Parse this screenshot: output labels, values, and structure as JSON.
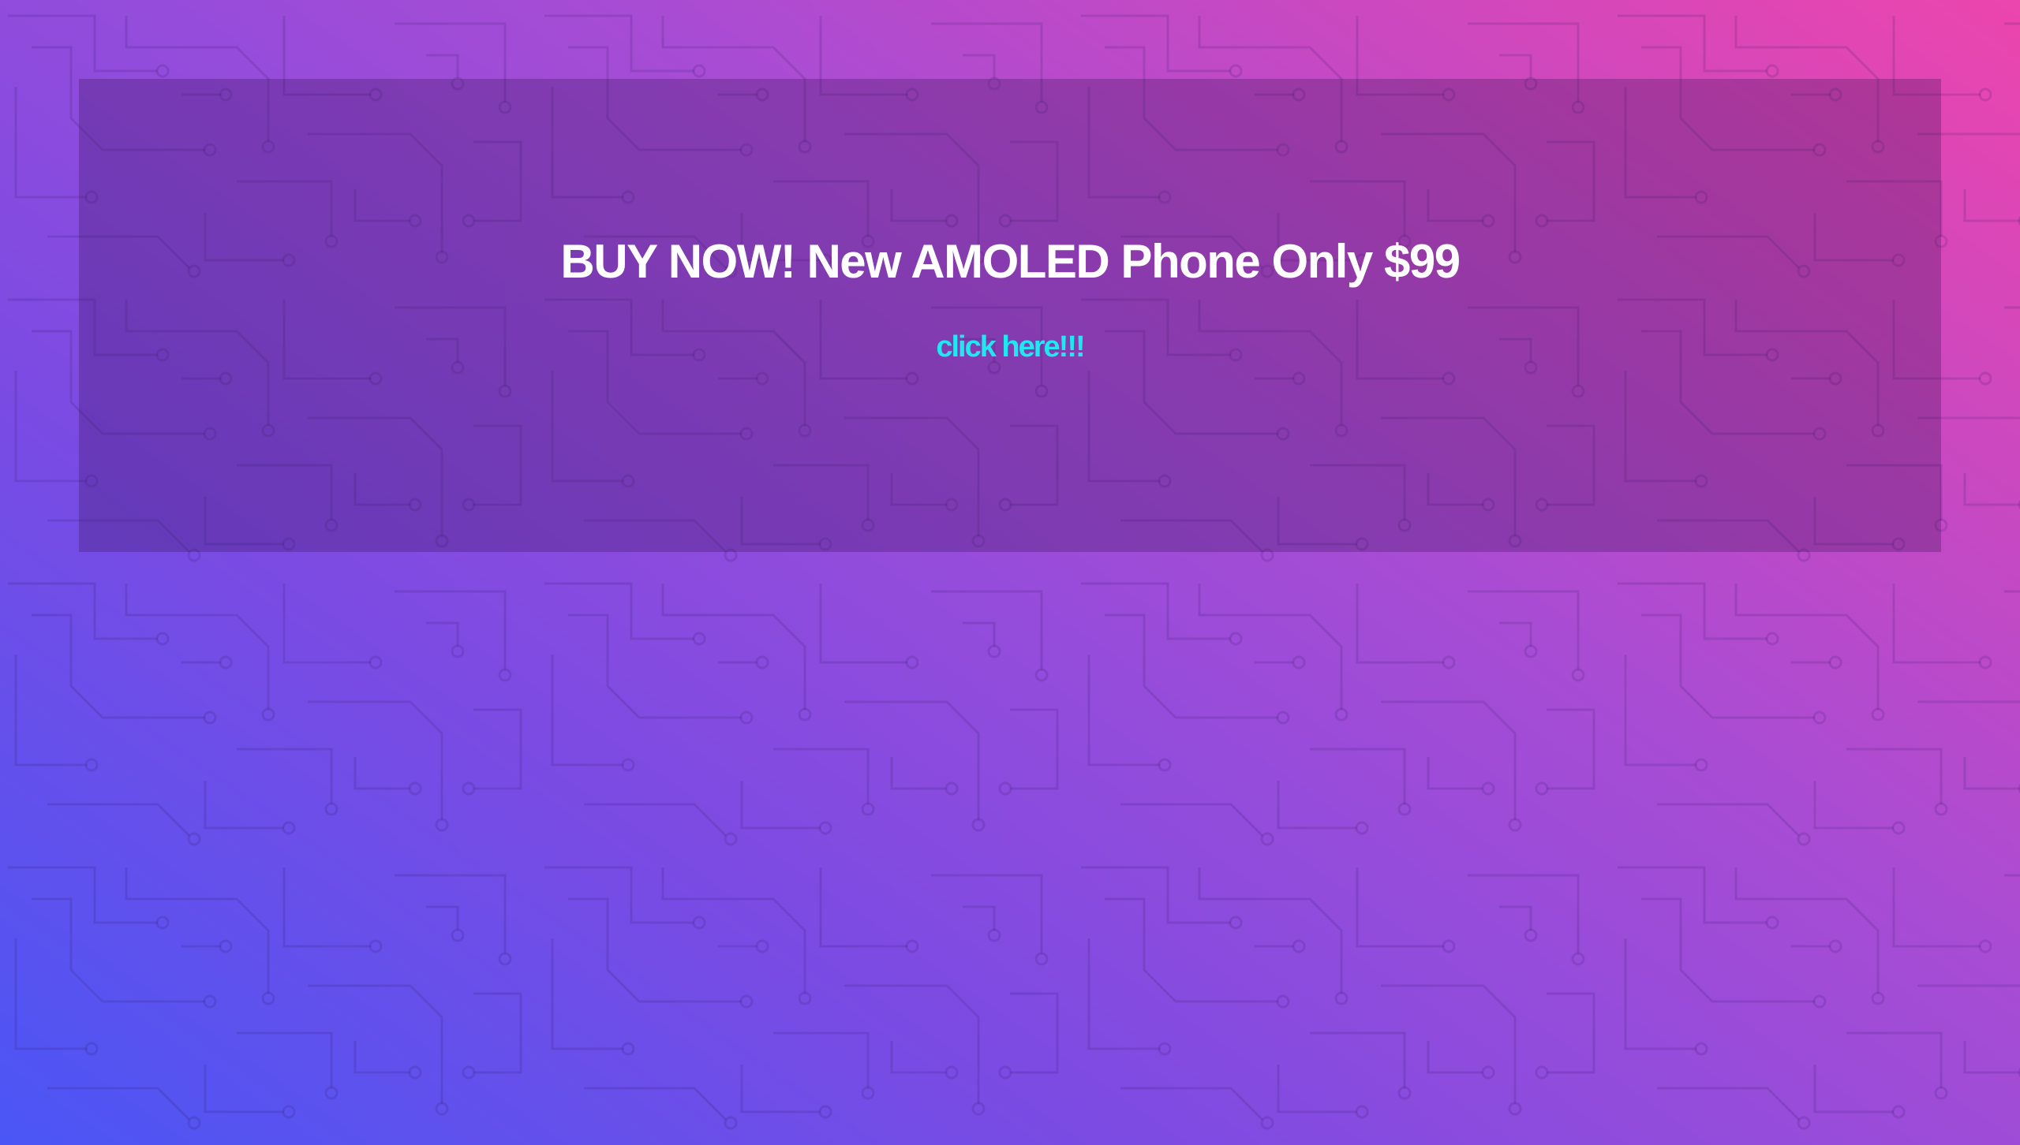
{
  "ad": {
    "headline": "BUY NOW! New AMOLED Phone Only $99",
    "link_text": "click here!!!"
  },
  "colors": {
    "gradient_start": "#4a56f5",
    "gradient_mid": "#a84cd4",
    "gradient_end": "#ec45ad",
    "headline_text": "#ffffff",
    "link_text": "#1fe8f0",
    "banner_overlay": "rgba(60,20,90,0.30)"
  },
  "background": {
    "pattern": "circuit-board-traces"
  }
}
